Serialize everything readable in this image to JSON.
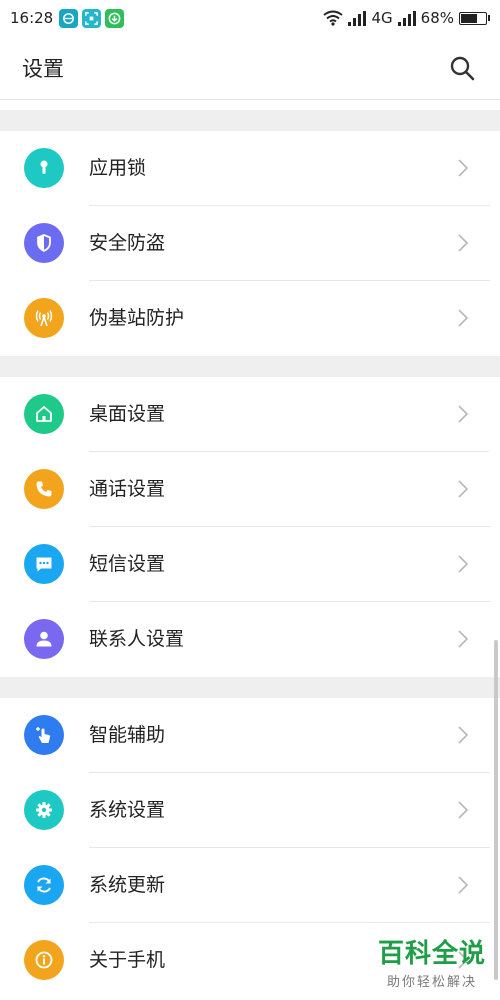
{
  "status_bar": {
    "time": "16:28",
    "network": "4G",
    "battery_percent": "68%",
    "battery_level": 0.68
  },
  "app_bar": {
    "title": "设置",
    "search_icon": "search-icon"
  },
  "groups": [
    {
      "items": [
        {
          "label": "应用锁",
          "icon": "keyhole-icon",
          "color": "#1ec9c4"
        },
        {
          "label": "安全防盗",
          "icon": "shield-icon",
          "color": "#6c6cf2"
        },
        {
          "label": "伪基站防护",
          "icon": "signal-tower-icon",
          "color": "#f2a51c"
        }
      ]
    },
    {
      "items": [
        {
          "label": "桌面设置",
          "icon": "home-icon",
          "color": "#1ec98a"
        },
        {
          "label": "通话设置",
          "icon": "phone-icon",
          "color": "#f2a51c"
        },
        {
          "label": "短信设置",
          "icon": "message-icon",
          "color": "#1aa6f0"
        },
        {
          "label": "联系人设置",
          "icon": "person-icon",
          "color": "#7b68f0"
        }
      ]
    },
    {
      "items": [
        {
          "label": "智能辅助",
          "icon": "touch-hand-icon",
          "color": "#2f7cf0"
        },
        {
          "label": "系统设置",
          "icon": "gear-icon",
          "color": "#1ec9c4"
        },
        {
          "label": "系统更新",
          "icon": "refresh-icon",
          "color": "#1aa6f0"
        },
        {
          "label": "关于手机",
          "icon": "info-icon",
          "color": "#f2a51c"
        }
      ]
    }
  ],
  "watermark": {
    "main": "百科全说",
    "sub": "助你轻松解决"
  }
}
